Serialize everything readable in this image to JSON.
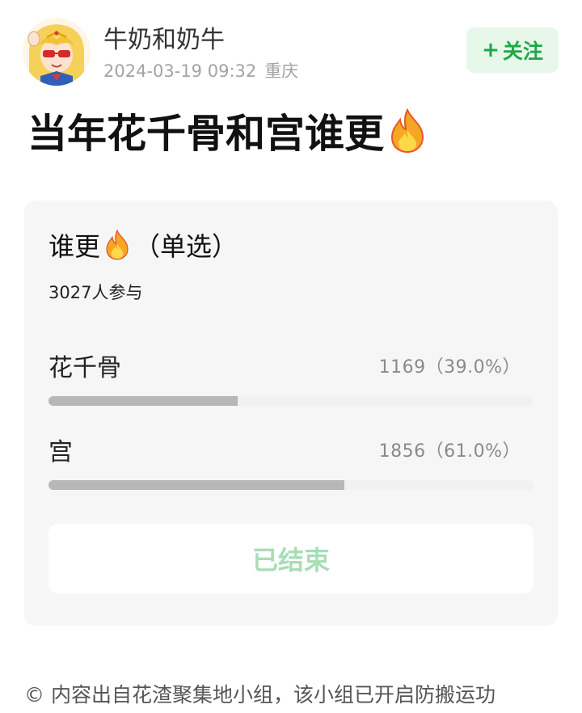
{
  "author": {
    "name": "牛奶和奶牛",
    "date": "2024-03-19 09:32",
    "location": "重庆"
  },
  "follow_button": {
    "label": "关注",
    "icon": "plus-icon"
  },
  "post": {
    "title": "当年花千骨和宫谁更",
    "title_emoji": "fire-icon"
  },
  "poll": {
    "question": "谁更",
    "question_emoji": "fire-icon",
    "type_label": "（单选）",
    "participants": "3027人参与",
    "options": [
      {
        "label": "花千骨",
        "count": "1169",
        "percent_text": "（39.0%）",
        "fraction": 0.39
      },
      {
        "label": "宫",
        "count": "1856",
        "percent_text": "（61.0%）",
        "fraction": 0.61
      }
    ],
    "status_button": "已结束"
  },
  "footer": {
    "icon": "copyright-icon",
    "text": "内容出自花渣聚集地小组，该小组已开启防搬运功"
  },
  "colors": {
    "accent_green": "#1fa845",
    "follow_bg": "#e7f7ea",
    "ended_text": "#a9ddb6",
    "bar_fill": "#b7b7b7"
  }
}
